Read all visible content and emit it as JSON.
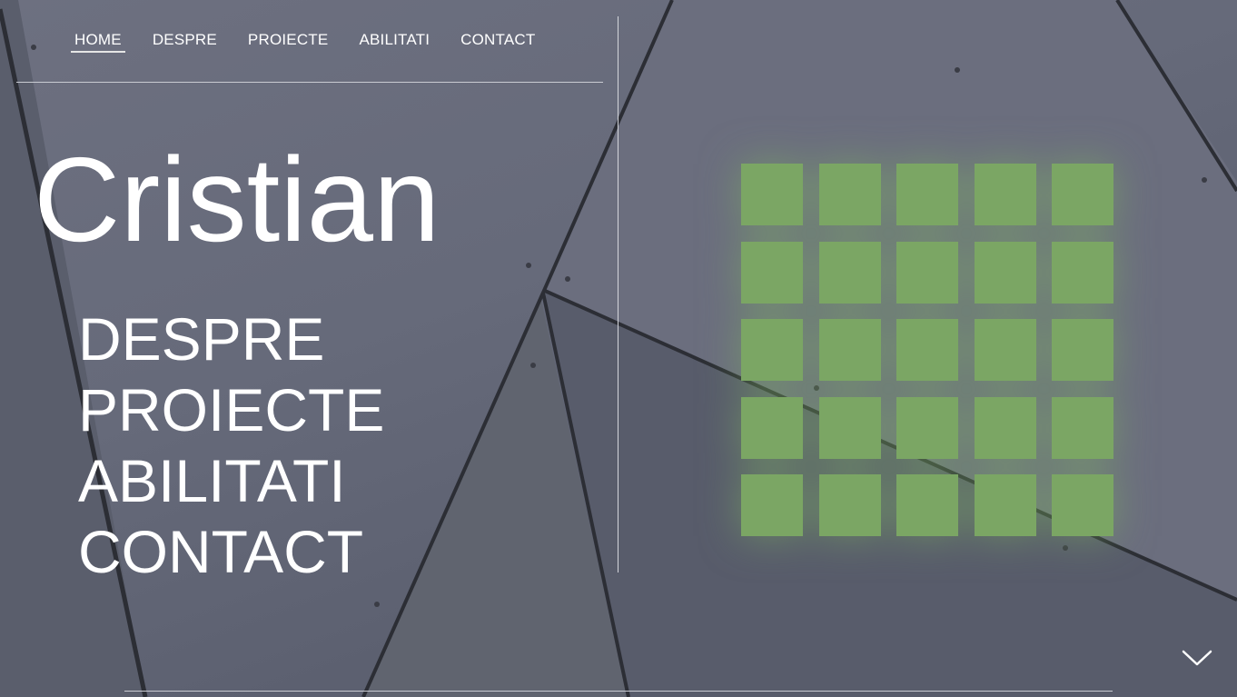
{
  "nav": {
    "items": [
      {
        "label": "HOME",
        "active": true
      },
      {
        "label": "DESPRE",
        "active": false
      },
      {
        "label": "PROIECTE",
        "active": false
      },
      {
        "label": "ABILITATI",
        "active": false
      },
      {
        "label": "CONTACT",
        "active": false
      }
    ]
  },
  "hero": {
    "name": "Cristian"
  },
  "menu": {
    "items": [
      "DESPRE",
      "PROIECTE",
      "ABILITATI",
      "CONTACT"
    ]
  },
  "tiles": {
    "rows": 5,
    "cols": 5,
    "color": "#7ba664"
  },
  "scroll": {
    "icon": "chevron-down-icon"
  },
  "colors": {
    "background": "#646878",
    "text": "#ffffff",
    "accent_green": "#7ba664"
  }
}
